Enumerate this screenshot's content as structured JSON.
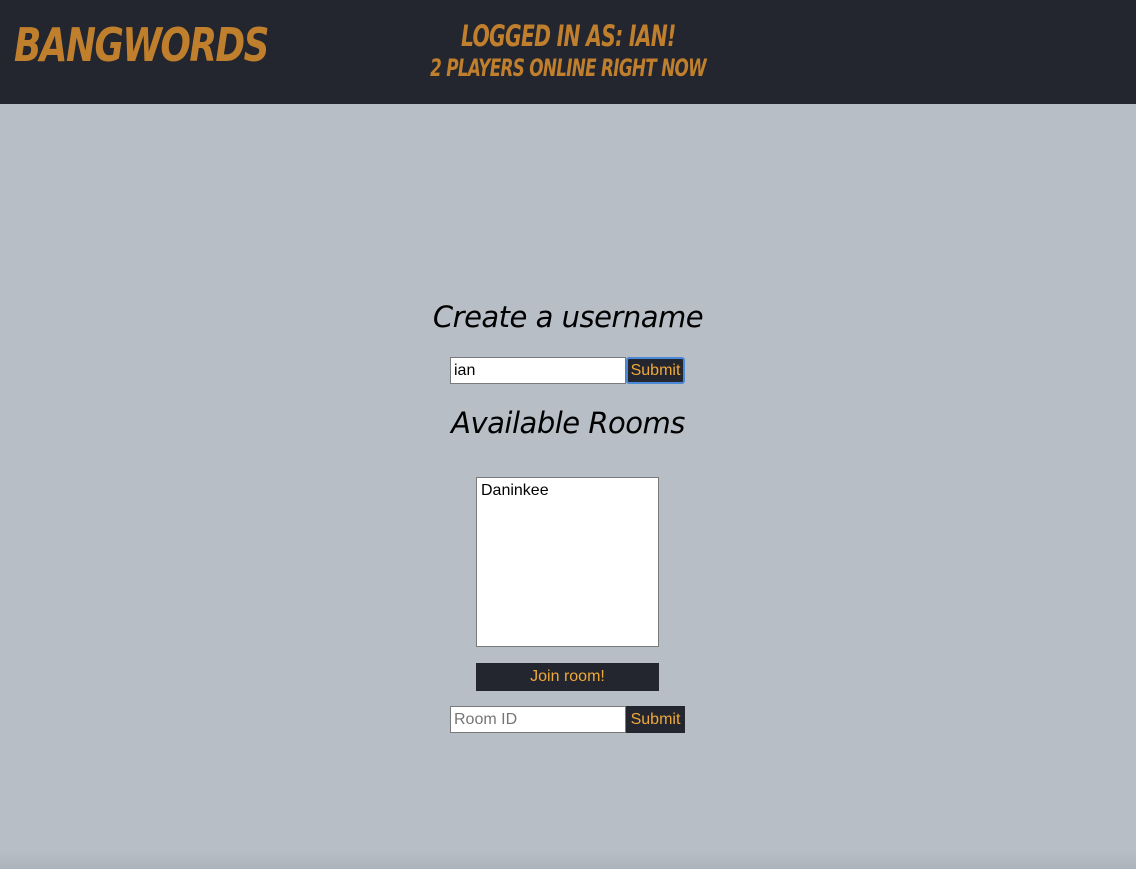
{
  "header": {
    "logo": "BANGWORDS",
    "logged_in": "LOGGED IN AS: IAN!",
    "online": "2 PLAYERS ONLINE RIGHT NOW"
  },
  "username_form": {
    "heading": "Create a username",
    "value": "ian",
    "submit_label": "Submit"
  },
  "rooms": {
    "heading": "Available Rooms",
    "items": [
      "Daninkee"
    ],
    "join_label": "Join room!"
  },
  "room_id_form": {
    "placeholder": "Room ID",
    "submit_label": "Submit"
  },
  "colors": {
    "background": "#b7bec6",
    "header": "#23262f",
    "brand": "#c07f2c",
    "button_text": "#f0a83a"
  }
}
